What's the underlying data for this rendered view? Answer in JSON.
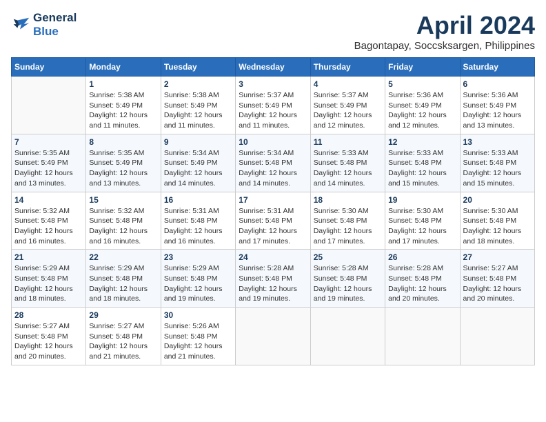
{
  "header": {
    "logo_line1": "General",
    "logo_line2": "Blue",
    "month": "April 2024",
    "location": "Bagontapay, Soccsksargen, Philippines"
  },
  "days_of_week": [
    "Sunday",
    "Monday",
    "Tuesday",
    "Wednesday",
    "Thursday",
    "Friday",
    "Saturday"
  ],
  "weeks": [
    [
      {
        "day": "",
        "info": ""
      },
      {
        "day": "1",
        "info": "Sunrise: 5:38 AM\nSunset: 5:49 PM\nDaylight: 12 hours and 11 minutes."
      },
      {
        "day": "2",
        "info": "Sunrise: 5:38 AM\nSunset: 5:49 PM\nDaylight: 12 hours and 11 minutes."
      },
      {
        "day": "3",
        "info": "Sunrise: 5:37 AM\nSunset: 5:49 PM\nDaylight: 12 hours and 11 minutes."
      },
      {
        "day": "4",
        "info": "Sunrise: 5:37 AM\nSunset: 5:49 PM\nDaylight: 12 hours and 12 minutes."
      },
      {
        "day": "5",
        "info": "Sunrise: 5:36 AM\nSunset: 5:49 PM\nDaylight: 12 hours and 12 minutes."
      },
      {
        "day": "6",
        "info": "Sunrise: 5:36 AM\nSunset: 5:49 PM\nDaylight: 12 hours and 13 minutes."
      }
    ],
    [
      {
        "day": "7",
        "info": "Sunrise: 5:35 AM\nSunset: 5:49 PM\nDaylight: 12 hours and 13 minutes."
      },
      {
        "day": "8",
        "info": "Sunrise: 5:35 AM\nSunset: 5:49 PM\nDaylight: 12 hours and 13 minutes."
      },
      {
        "day": "9",
        "info": "Sunrise: 5:34 AM\nSunset: 5:49 PM\nDaylight: 12 hours and 14 minutes."
      },
      {
        "day": "10",
        "info": "Sunrise: 5:34 AM\nSunset: 5:48 PM\nDaylight: 12 hours and 14 minutes."
      },
      {
        "day": "11",
        "info": "Sunrise: 5:33 AM\nSunset: 5:48 PM\nDaylight: 12 hours and 14 minutes."
      },
      {
        "day": "12",
        "info": "Sunrise: 5:33 AM\nSunset: 5:48 PM\nDaylight: 12 hours and 15 minutes."
      },
      {
        "day": "13",
        "info": "Sunrise: 5:33 AM\nSunset: 5:48 PM\nDaylight: 12 hours and 15 minutes."
      }
    ],
    [
      {
        "day": "14",
        "info": "Sunrise: 5:32 AM\nSunset: 5:48 PM\nDaylight: 12 hours and 16 minutes."
      },
      {
        "day": "15",
        "info": "Sunrise: 5:32 AM\nSunset: 5:48 PM\nDaylight: 12 hours and 16 minutes."
      },
      {
        "day": "16",
        "info": "Sunrise: 5:31 AM\nSunset: 5:48 PM\nDaylight: 12 hours and 16 minutes."
      },
      {
        "day": "17",
        "info": "Sunrise: 5:31 AM\nSunset: 5:48 PM\nDaylight: 12 hours and 17 minutes."
      },
      {
        "day": "18",
        "info": "Sunrise: 5:30 AM\nSunset: 5:48 PM\nDaylight: 12 hours and 17 minutes."
      },
      {
        "day": "19",
        "info": "Sunrise: 5:30 AM\nSunset: 5:48 PM\nDaylight: 12 hours and 17 minutes."
      },
      {
        "day": "20",
        "info": "Sunrise: 5:30 AM\nSunset: 5:48 PM\nDaylight: 12 hours and 18 minutes."
      }
    ],
    [
      {
        "day": "21",
        "info": "Sunrise: 5:29 AM\nSunset: 5:48 PM\nDaylight: 12 hours and 18 minutes."
      },
      {
        "day": "22",
        "info": "Sunrise: 5:29 AM\nSunset: 5:48 PM\nDaylight: 12 hours and 18 minutes."
      },
      {
        "day": "23",
        "info": "Sunrise: 5:29 AM\nSunset: 5:48 PM\nDaylight: 12 hours and 19 minutes."
      },
      {
        "day": "24",
        "info": "Sunrise: 5:28 AM\nSunset: 5:48 PM\nDaylight: 12 hours and 19 minutes."
      },
      {
        "day": "25",
        "info": "Sunrise: 5:28 AM\nSunset: 5:48 PM\nDaylight: 12 hours and 19 minutes."
      },
      {
        "day": "26",
        "info": "Sunrise: 5:28 AM\nSunset: 5:48 PM\nDaylight: 12 hours and 20 minutes."
      },
      {
        "day": "27",
        "info": "Sunrise: 5:27 AM\nSunset: 5:48 PM\nDaylight: 12 hours and 20 minutes."
      }
    ],
    [
      {
        "day": "28",
        "info": "Sunrise: 5:27 AM\nSunset: 5:48 PM\nDaylight: 12 hours and 20 minutes."
      },
      {
        "day": "29",
        "info": "Sunrise: 5:27 AM\nSunset: 5:48 PM\nDaylight: 12 hours and 21 minutes."
      },
      {
        "day": "30",
        "info": "Sunrise: 5:26 AM\nSunset: 5:48 PM\nDaylight: 12 hours and 21 minutes."
      },
      {
        "day": "",
        "info": ""
      },
      {
        "day": "",
        "info": ""
      },
      {
        "day": "",
        "info": ""
      },
      {
        "day": "",
        "info": ""
      }
    ]
  ]
}
